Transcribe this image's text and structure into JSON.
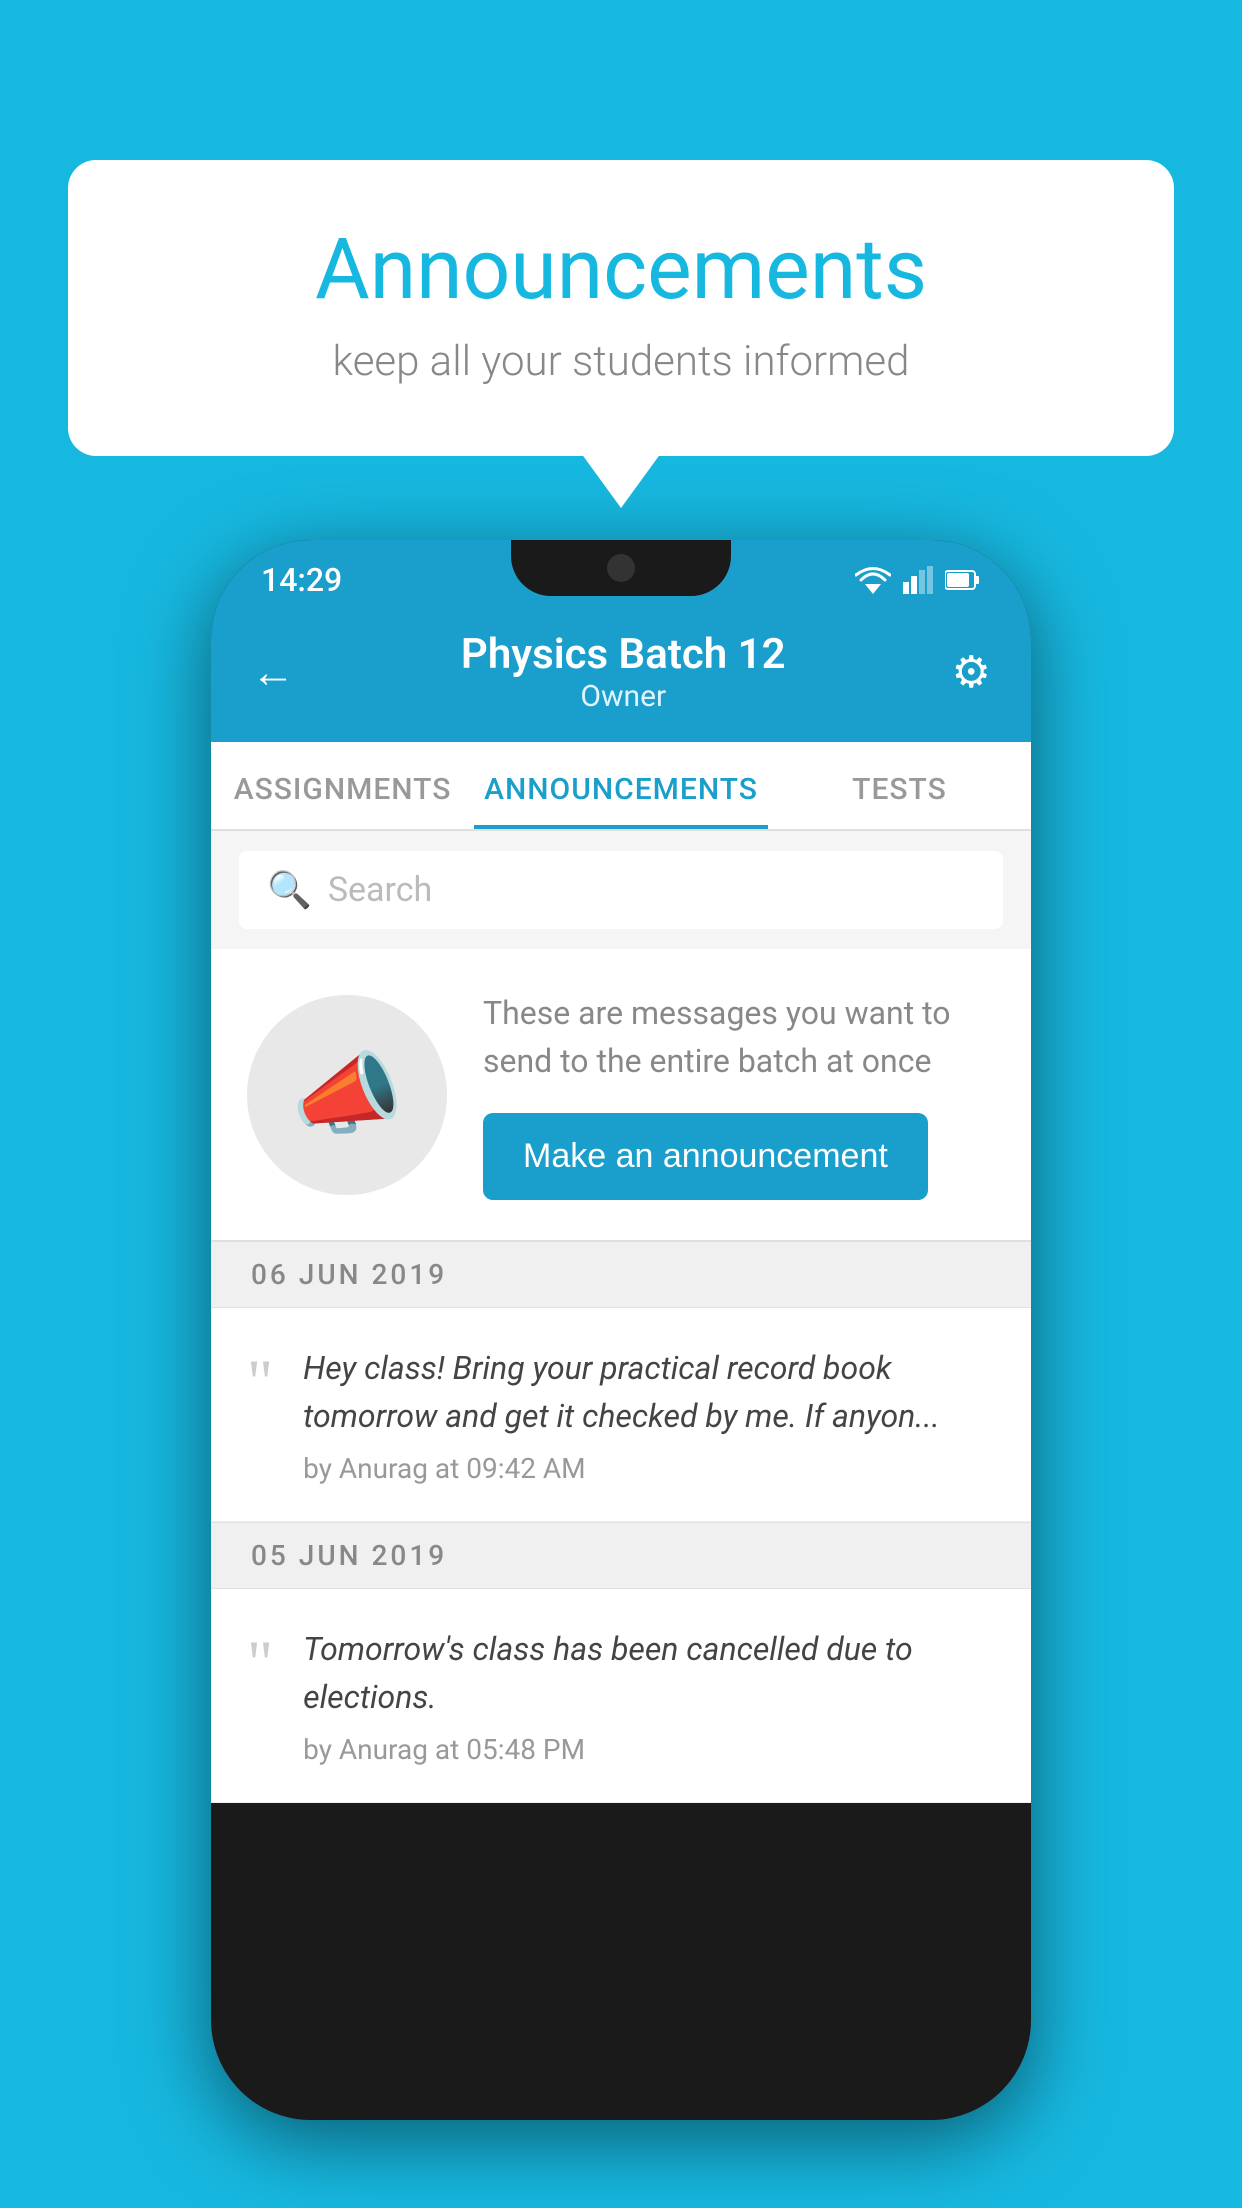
{
  "background_color": "#17b8e0",
  "speech_bubble": {
    "title": "Announcements",
    "subtitle": "keep all your students informed"
  },
  "phone": {
    "status_bar": {
      "time": "14:29"
    },
    "header": {
      "title": "Physics Batch 12",
      "subtitle": "Owner",
      "back_label": "←",
      "gear_label": "⚙"
    },
    "tabs": [
      {
        "label": "ASSIGNMENTS",
        "active": false
      },
      {
        "label": "ANNOUNCEMENTS",
        "active": true
      },
      {
        "label": "TESTS",
        "active": false
      }
    ],
    "search": {
      "placeholder": "Search"
    },
    "promo": {
      "description": "These are messages you want to send to the entire batch at once",
      "button_label": "Make an announcement"
    },
    "announcements": [
      {
        "date": "06  JUN  2019",
        "text": "Hey class! Bring your practical record book tomorrow and get it checked by me. If anyon...",
        "meta": "by Anurag at 09:42 AM"
      },
      {
        "date": "05  JUN  2019",
        "text": "Tomorrow's class has been cancelled due to elections.",
        "meta": "by Anurag at 05:48 PM"
      }
    ]
  }
}
